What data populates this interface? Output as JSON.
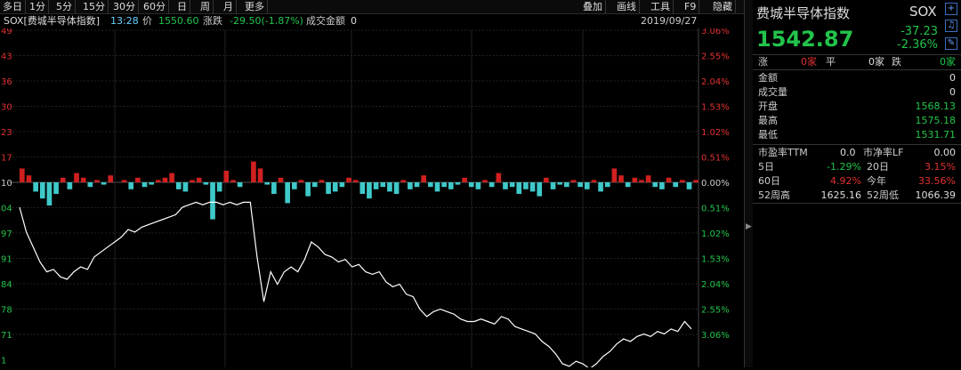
{
  "toolbar": {
    "items": [
      "多日",
      "1分",
      "5分",
      "15分",
      "30分",
      "60分",
      "日",
      "周",
      "月",
      "更多"
    ],
    "right_items": [
      "叠加",
      "画线",
      "工具",
      "F9",
      "隐藏"
    ]
  },
  "info": {
    "name": "SOX[费城半导体指数]",
    "time": "13:28",
    "price_label": "价",
    "price": "1550.60",
    "change_label": "涨跌",
    "change": "-29.50(-1.87%)",
    "volume_label": "成交金额",
    "volume": "0",
    "date": "2019/09/27"
  },
  "axis": {
    "left": [
      "49",
      "43",
      "36",
      "30",
      "23",
      "17",
      "10",
      "04",
      "97",
      "91",
      "84",
      "78",
      "71",
      "1"
    ],
    "right": [
      "3.06%",
      "2.55%",
      "2.04%",
      "1.53%",
      "1.02%",
      "0.51%",
      "0.00%",
      "0.51%",
      "1.02%",
      "1.53%",
      "2.04%",
      "2.55%",
      "3.06%"
    ]
  },
  "chart_data": {
    "type": "line",
    "title": "",
    "series": [
      {
        "values": [
          0.0,
          -0.5,
          -0.8,
          -1.1,
          -1.3,
          -1.25,
          -1.4,
          -1.45,
          -1.3,
          -1.2,
          -1.25,
          -1.0,
          -0.9,
          -0.8,
          -0.7,
          -0.6,
          -0.45,
          -0.5,
          -0.4,
          -0.35,
          -0.3,
          -0.25,
          -0.2,
          -0.15,
          -0.0,
          0.05,
          0.1,
          0.05,
          0.1,
          0.1,
          0.05,
          0.1,
          0.05,
          0.1,
          0.1,
          -1.0,
          -1.9,
          -1.3,
          -1.55,
          -1.3,
          -1.2,
          -1.3,
          -1.05,
          -0.7,
          -0.8,
          -0.95,
          -1.0,
          -1.1,
          -1.05,
          -1.2,
          -1.15,
          -1.3,
          -1.35,
          -1.3,
          -1.5,
          -1.6,
          -1.55,
          -1.75,
          -1.8,
          -2.05,
          -2.2,
          -2.1,
          -2.05,
          -2.1,
          -2.15,
          -2.25,
          -2.3,
          -2.3,
          -2.25,
          -2.3,
          -2.35,
          -2.2,
          -2.25,
          -2.4,
          -2.45,
          -2.5,
          -2.55,
          -2.7,
          -2.8,
          -2.95,
          -3.15,
          -3.2,
          -3.1,
          -3.15,
          -3.25,
          -3.15,
          -3.0,
          -2.9,
          -2.75,
          -2.65,
          -2.7,
          -2.6,
          -2.55,
          -2.6,
          -2.5,
          -2.55,
          -2.45,
          -2.5,
          -2.3,
          -2.45
        ]
      }
    ],
    "volume_bars": [
      0.6,
      0.3,
      -0.4,
      -0.7,
      -1.0,
      -0.5,
      0.2,
      -0.3,
      0.4,
      0.2,
      -0.2,
      0.1,
      -0.1,
      0.3,
      0.0,
      0.1,
      -0.3,
      0.2,
      -0.2,
      -0.1,
      0.1,
      0.2,
      0.4,
      -0.3,
      -0.4,
      0.1,
      0.2,
      -0.1,
      -1.6,
      -0.4,
      0.5,
      0.1,
      -0.2,
      0.0,
      0.9,
      0.6,
      -0.1,
      -0.5,
      0.2,
      -0.9,
      -0.3,
      0.1,
      -0.6,
      -0.2,
      0.1,
      -0.5,
      -0.4,
      -0.2,
      0.2,
      0.1,
      -0.5,
      -0.7,
      -0.3,
      -0.2,
      -0.4,
      -0.5,
      0.1,
      -0.3,
      -0.2,
      0.3,
      -0.2,
      -0.4,
      -0.2,
      -0.3,
      -0.1,
      0.2,
      -0.2,
      -0.3,
      0.1,
      -0.2,
      0.4,
      -0.3,
      -0.2,
      -0.5,
      -0.3,
      -0.4,
      -0.6,
      0.2,
      -0.3,
      -0.1,
      -0.2,
      0.1,
      -0.2,
      -0.3,
      0.1,
      -0.4,
      -0.2,
      0.6,
      0.3,
      -0.2,
      0.2,
      0.1,
      0.3,
      -0.2,
      -0.3,
      0.2,
      -0.2,
      0.1,
      -0.3,
      0.1
    ],
    "ylim": [
      -3.06,
      3.06
    ]
  },
  "quote": {
    "title": "费城半导体指数",
    "code": "SOX",
    "price": "1542.87",
    "change": "-37.23",
    "change_pct": "-2.36%",
    "up_label": "涨",
    "up_val": "0家",
    "flat_label": "平",
    "flat_val": "0家",
    "down_label": "跌",
    "down_val": "0家",
    "rows": [
      {
        "label": "金额",
        "value": "0"
      },
      {
        "label": "成交量",
        "value": "0"
      },
      {
        "label": "开盘",
        "value": "1568.13"
      },
      {
        "label": "最高",
        "value": "1575.18"
      },
      {
        "label": "最低",
        "value": "1531.71"
      }
    ],
    "pe_label": "市盈率TTM",
    "pe_val": "0.0",
    "pb_label": "市净率LF",
    "pb_val": "0.00",
    "stats": [
      {
        "l1": "5日",
        "v1": "-1.29%",
        "l2": "20日",
        "v2": "3.15%"
      },
      {
        "l1": "60日",
        "v1": "4.92%",
        "l2": "今年",
        "v2": "33.56%"
      },
      {
        "l1": "52周高",
        "v1": "1625.16",
        "l2": "52周低",
        "v2": "1066.39"
      }
    ],
    "colors": {
      "up": "#e03030",
      "down": "#22c44c"
    }
  }
}
